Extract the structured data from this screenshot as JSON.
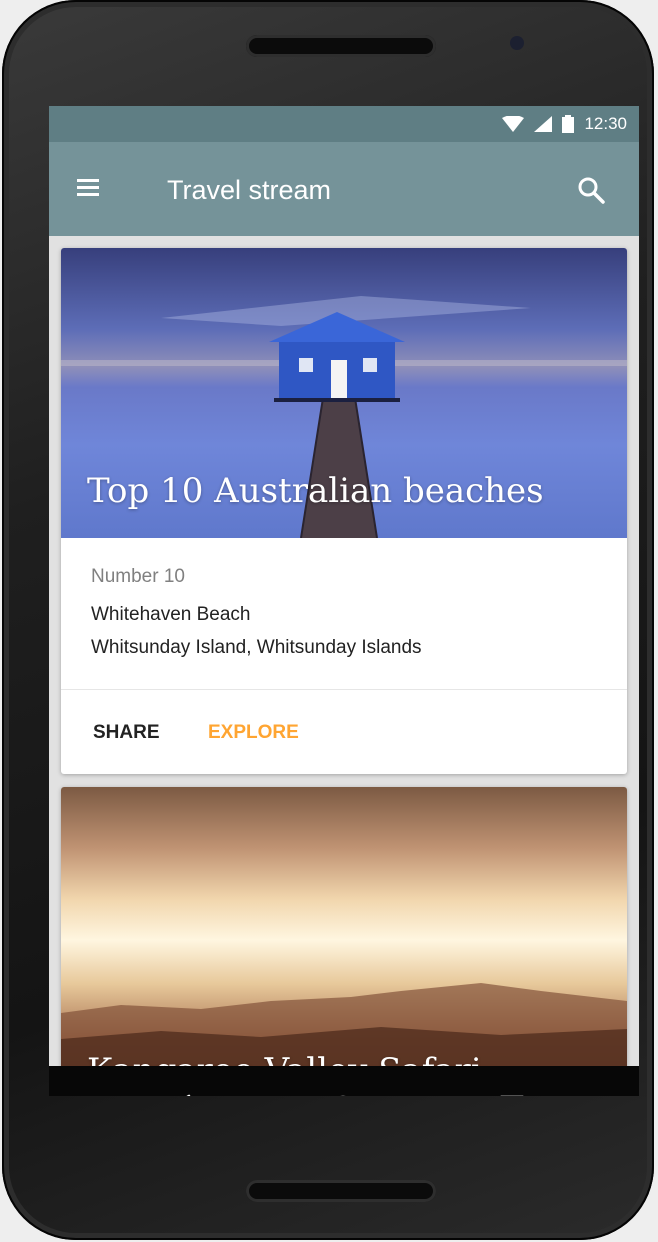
{
  "status_bar": {
    "time": "12:30"
  },
  "app_bar": {
    "title": "Travel stream"
  },
  "cards": [
    {
      "title": "Top 10 Australian beaches",
      "overline": "Number 10",
      "line1": "Whitehaven Beach",
      "line2": "Whitsunday Island, Whitsunday Islands",
      "actions": {
        "share": "SHARE",
        "explore": "EXPLORE"
      }
    },
    {
      "title": "Kangaroo Valley Safari"
    }
  ],
  "colors": {
    "app_bar": "#759399",
    "status_bar": "#5f7e84",
    "accent": "#ffa532"
  },
  "icons": [
    "menu-icon",
    "search-icon",
    "wifi-icon",
    "signal-icon",
    "battery-icon",
    "back-icon",
    "home-icon",
    "recents-icon"
  ]
}
